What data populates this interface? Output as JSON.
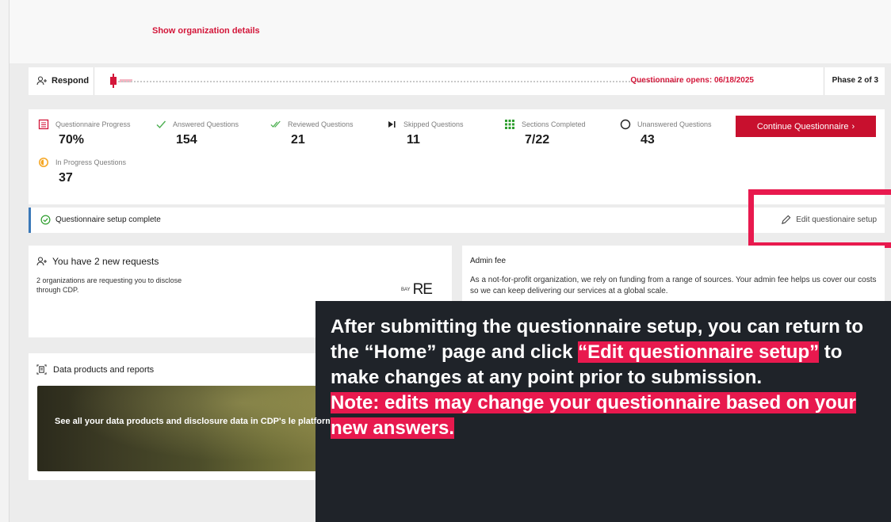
{
  "header": {
    "org_link": "Show organization details"
  },
  "timeline": {
    "respond_label": "Respond",
    "opens_label": "Questionnaire opens: 06/18/2025",
    "phase_label": "Phase 2 of 3",
    "progress_fraction": 0.03
  },
  "stats": {
    "items": [
      {
        "label": "Questionnaire Progress",
        "value": "70%",
        "icon": "list-icon"
      },
      {
        "label": "Answered Questions",
        "value": "154",
        "icon": "check-icon"
      },
      {
        "label": "Reviewed Questions",
        "value": "21",
        "icon": "double-check-icon"
      },
      {
        "label": "Skipped Questions",
        "value": "11",
        "icon": "skip-icon"
      },
      {
        "label": "Sections Completed",
        "value": "7/22",
        "icon": "grid-icon"
      },
      {
        "label": "Unanswered Questions",
        "value": "43",
        "icon": "circle-icon"
      },
      {
        "label": "In Progress Questions",
        "value": "37",
        "icon": "half-circle-icon"
      }
    ],
    "continue_label": "Continue Questionnaire"
  },
  "setup": {
    "status": "Questionnaire setup complete",
    "edit_label": "Edit questionaire setup"
  },
  "requests": {
    "title": "You have 2 new requests",
    "text": "2 organizations are requesting you to disclose through CDP.",
    "logo_small": "BAY",
    "logo_big": "RE"
  },
  "admin": {
    "title": "Admin fee",
    "text": "As a not-for-profit organization, we rely on funding from a range of sources. Your admin fee helps us cover our costs so we can keep delivering our services at a global scale."
  },
  "data_products": {
    "title": "Data products and reports",
    "banner_text": "See all your data products and disclosure data in CDP's le platform."
  },
  "callout": {
    "line1": "After submitting the questionnaire setup, you can return to the “Home” page and click ",
    "highlight1": "“Edit questionnaire setup”",
    "line2": " to make changes at any point prior to submission.",
    "note": "Note: edits may change your questionnaire based on your new answers."
  },
  "colors": {
    "accent": "#c8102e",
    "highlight": "#e8194e",
    "setup_border": "#3a78b8",
    "callout_bg": "#1f2329"
  }
}
